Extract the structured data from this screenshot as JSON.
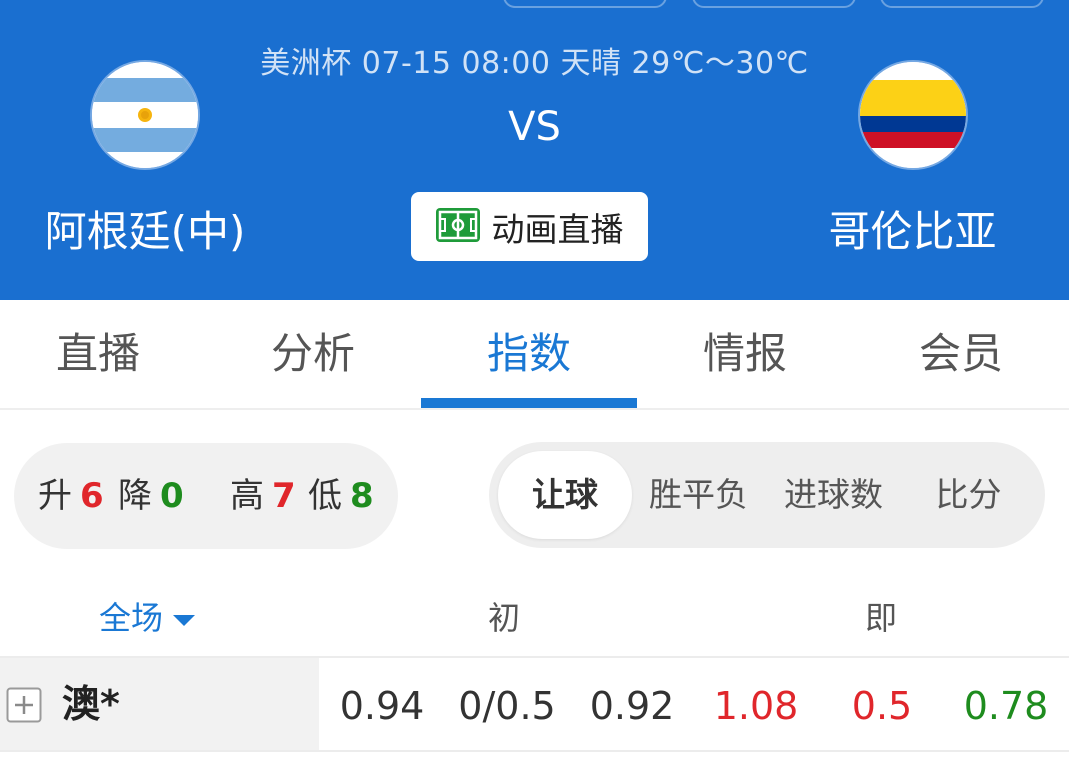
{
  "match": {
    "info": "美洲杯 07-15 08:00 天晴 29℃～30℃",
    "vs": "VS",
    "home_team": "阿根廷(中)",
    "away_team": "哥伦比亚",
    "animation_button": "动画直播"
  },
  "colors": {
    "header_bg": "#1a6fd0",
    "accent": "#1a78d4",
    "up_red": "#e0262b",
    "down_green": "#1e8c1e"
  },
  "tabs": [
    {
      "label": "直播",
      "active": false
    },
    {
      "label": "分析",
      "active": false
    },
    {
      "label": "指数",
      "active": true
    },
    {
      "label": "情报",
      "active": false
    },
    {
      "label": "会员",
      "active": false
    }
  ],
  "stats": {
    "up_label": "升",
    "up_value": "6",
    "down_label": "降",
    "down_value": "0",
    "high_label": "高",
    "high_value": "7",
    "low_label": "低",
    "low_value": "8"
  },
  "odds_types": [
    {
      "label": "让球",
      "active": true
    },
    {
      "label": "胜平负",
      "active": false
    },
    {
      "label": "进球数",
      "active": false
    },
    {
      "label": "比分",
      "active": false
    }
  ],
  "table": {
    "scope_label": "全场",
    "initial_label": "初",
    "live_label": "即",
    "rows": [
      {
        "company": "澳*",
        "initial": [
          "0.94",
          "0/0.5",
          "0.92"
        ],
        "live": [
          "1.08",
          "0.5",
          "0.78"
        ]
      }
    ]
  },
  "icons": {
    "home_flag": "argentina-flag-icon",
    "away_flag": "colombia-flag-icon",
    "animation": "pitch-icon",
    "dropdown": "caret-down-icon",
    "expand": "plus-box-icon"
  }
}
